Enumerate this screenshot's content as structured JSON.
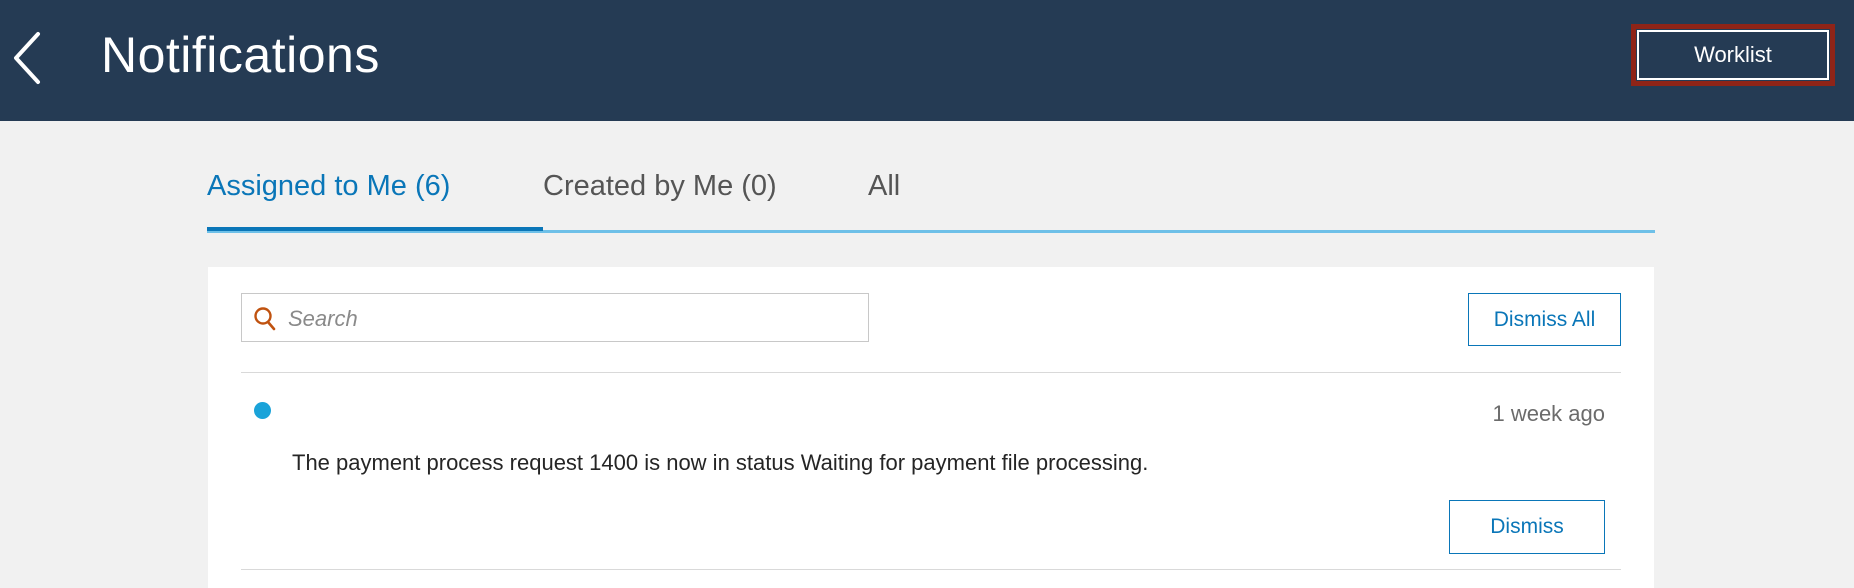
{
  "header": {
    "title": "Notifications",
    "back_icon": "chevron-left-icon",
    "worklist_label": "Worklist",
    "background_color": "#253b54",
    "highlight_color": "#8f2418"
  },
  "tabs": [
    {
      "label": "Assigned to Me (6)",
      "active": true
    },
    {
      "label": "Created by Me (0)",
      "active": false
    },
    {
      "label": "All",
      "active": false
    }
  ],
  "toolbar": {
    "search_placeholder": "Search",
    "search_icon": "search-icon",
    "dismiss_all_label": "Dismiss All"
  },
  "notifications": [
    {
      "unread": true,
      "timestamp": "1 week ago",
      "message": "The payment process request 1400 is now in status Waiting for payment file processing.",
      "dismiss_label": "Dismiss"
    }
  ],
  "colors": {
    "accent": "#0a76b8",
    "unread_dot": "#1aa3d9",
    "tab_line": "#6ec0e8"
  }
}
